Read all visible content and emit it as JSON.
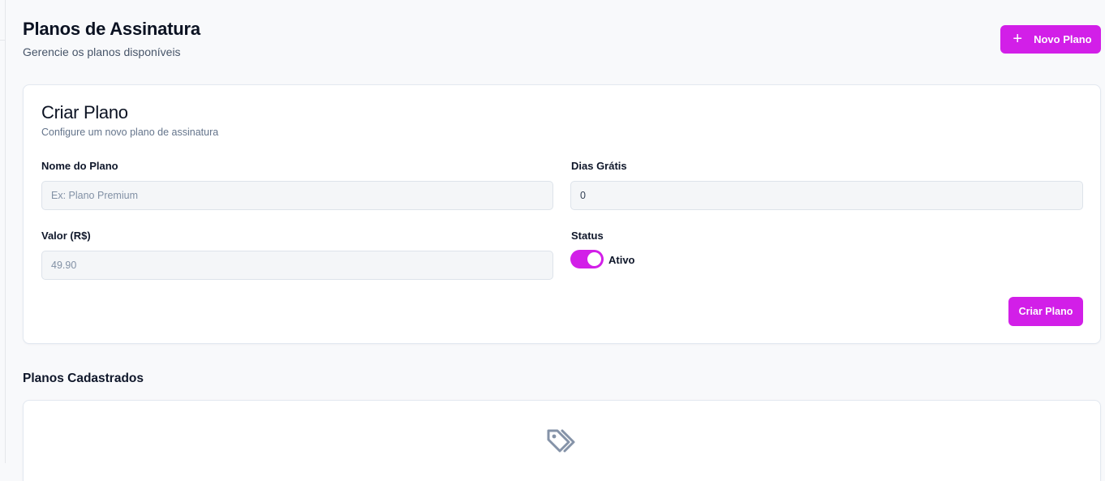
{
  "header": {
    "title": "Planos de Assinatura",
    "subtitle": "Gerencie os planos disponíveis",
    "new_plan_icon": "plus-icon",
    "new_plan_label": "Novo Plano"
  },
  "create_form": {
    "title": "Criar Plano",
    "subtitle": "Configure um novo plano de assinatura",
    "plan_name": {
      "label": "Nome do Plano",
      "placeholder": "Ex: Plano Premium",
      "value": ""
    },
    "free_days": {
      "label": "Dias Grátis",
      "value": "0"
    },
    "price": {
      "label": "Valor (R$)",
      "value": "",
      "placeholder": "49.90"
    },
    "status": {
      "label": "Status",
      "toggle_label": "Ativo",
      "on": true
    },
    "submit_label": "Criar Plano"
  },
  "plans_list": {
    "title": "Planos Cadastrados",
    "empty_icon": "tags-icon"
  },
  "colors": {
    "accent": "#d21fe8",
    "background": "#f8f9fb",
    "card": "#ffffff",
    "input_bg": "#f4f6f8"
  }
}
